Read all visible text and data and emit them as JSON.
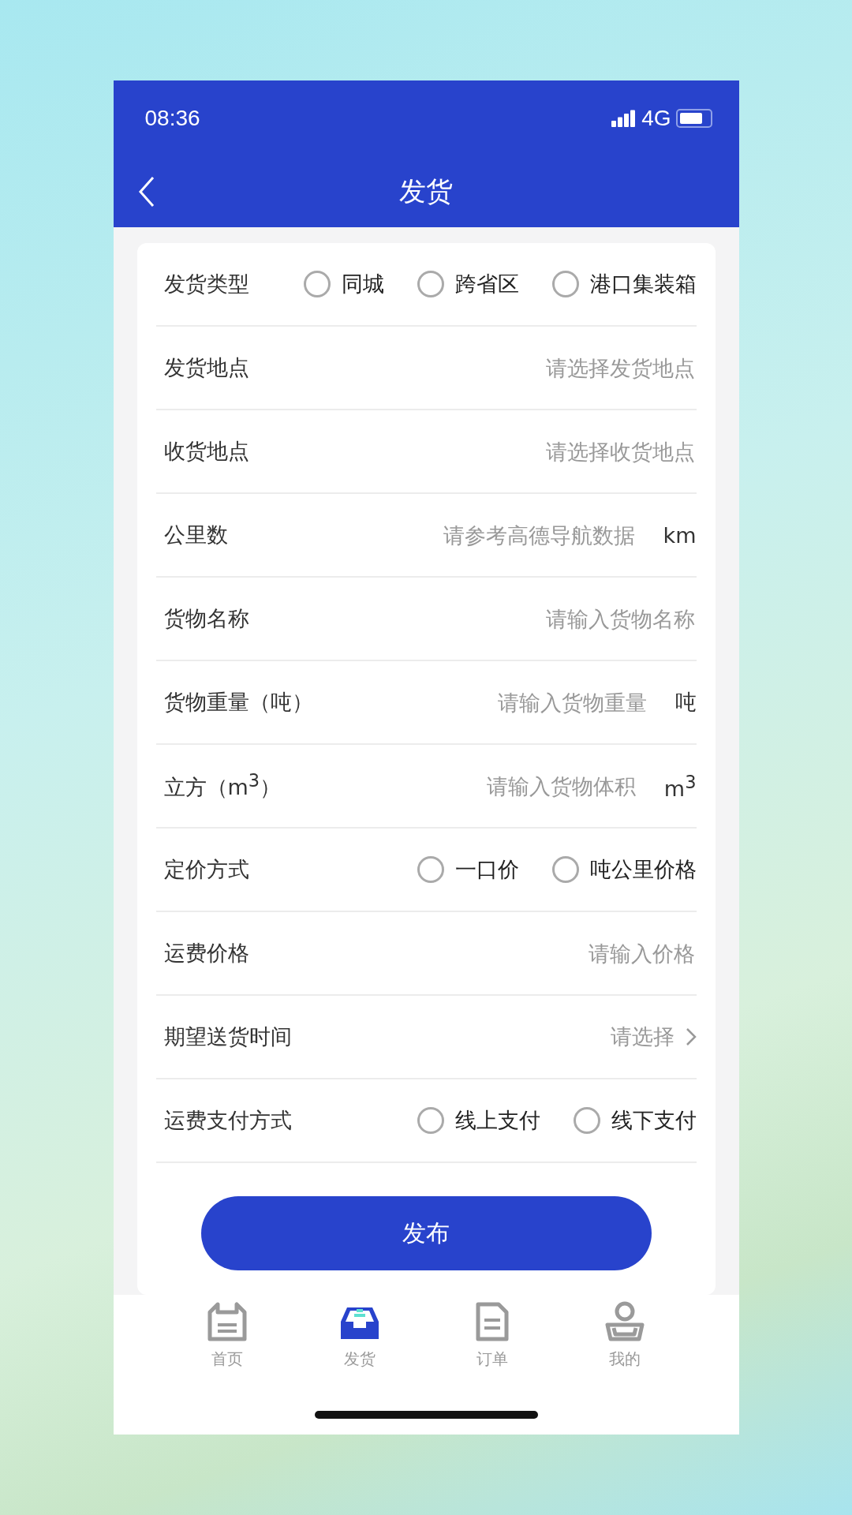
{
  "status_bar": {
    "time": "08:36",
    "network": "4G"
  },
  "nav": {
    "title": "发货"
  },
  "fields": [
    {
      "kind": "radio",
      "label": "发货类型",
      "options": [
        {
          "label": "同城",
          "selected": false
        },
        {
          "label": "跨省区",
          "selected": false
        },
        {
          "label": "港口集装箱",
          "selected": false
        }
      ]
    },
    {
      "kind": "input",
      "label": "发货地点",
      "placeholder": "请选择发货地点"
    },
    {
      "kind": "input",
      "label": "收货地点",
      "placeholder": "请选择收货地点"
    },
    {
      "kind": "input",
      "label": "公里数",
      "placeholder": "请参考高德导航数据",
      "unit": "km"
    },
    {
      "kind": "input",
      "label": "货物名称",
      "placeholder": "请输入货物名称"
    },
    {
      "kind": "input",
      "label": "货物重量（吨）",
      "placeholder": "请输入货物重量",
      "unit": "吨"
    },
    {
      "kind": "input",
      "label": "立方（m$^{3}$）",
      "placeholder": "请输入货物体积",
      "unit": "m$^{3}$"
    },
    {
      "kind": "radio",
      "label": "定价方式",
      "options": [
        {
          "label": "一口价",
          "selected": false
        },
        {
          "label": "吨公里价格",
          "selected": false
        }
      ]
    },
    {
      "kind": "input",
      "label": "运费价格",
      "placeholder": "请输入价格"
    },
    {
      "kind": "select",
      "label": "期望送货时间",
      "placeholder": "请选择"
    },
    {
      "kind": "radio",
      "label": "运费支付方式",
      "options": [
        {
          "label": "线上支付",
          "selected": false
        },
        {
          "label": "线下支付",
          "selected": false
        }
      ]
    }
  ],
  "submit": "发布",
  "tabs": [
    {
      "label": "首页",
      "selected": false
    },
    {
      "label": "发货",
      "selected": true
    },
    {
      "label": "订单",
      "selected": false
    },
    {
      "label": "我的",
      "selected": false
    }
  ]
}
